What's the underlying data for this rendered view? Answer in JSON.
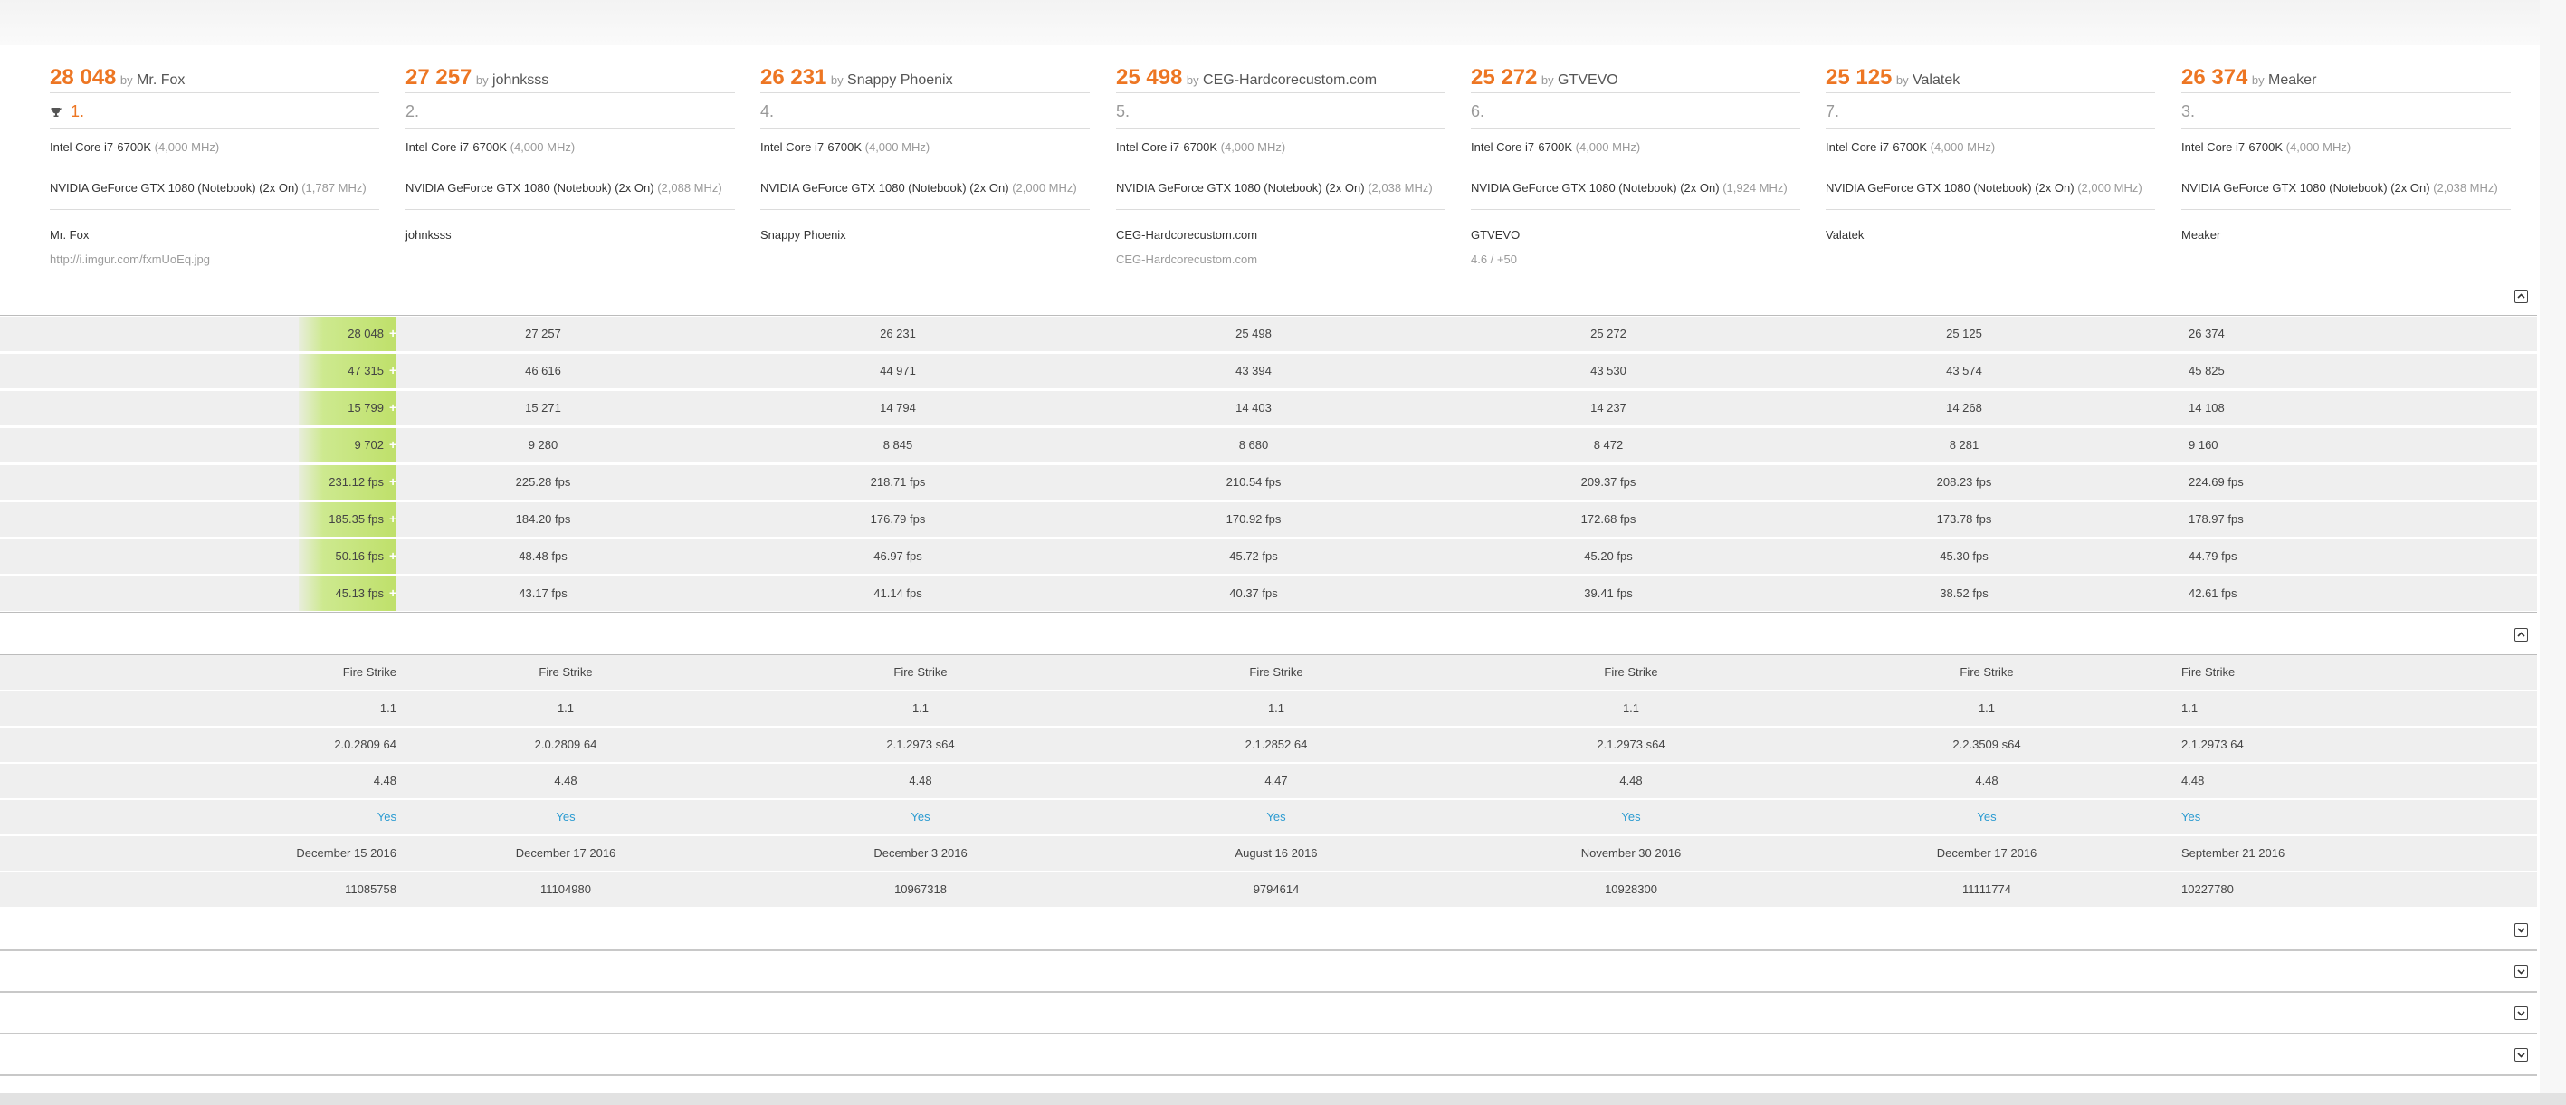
{
  "submissions": [
    {
      "score": "28 048",
      "by": "by",
      "author": "Mr. Fox",
      "rank": "1.",
      "cpu": "Intel Core i7-6700K",
      "cpu_freq": "(4,000 MHz)",
      "gpu": "NVIDIA GeForce GTX 1080 (Notebook) (2x On)",
      "gpu_freq": "(1,787 MHz)",
      "user": "Mr. Fox",
      "note": "http://i.imgur.com/fxmUoEq.jpg"
    },
    {
      "score": "27 257",
      "by": "by",
      "author": "johnksss",
      "rank": "2.",
      "cpu": "Intel Core i7-6700K",
      "cpu_freq": "(4,000 MHz)",
      "gpu": "NVIDIA GeForce GTX 1080 (Notebook) (2x On)",
      "gpu_freq": "(2,088 MHz)",
      "user": "johnksss",
      "note": ""
    },
    {
      "score": "26 231",
      "by": "by",
      "author": "Snappy Phoenix",
      "rank": "4.",
      "cpu": "Intel Core i7-6700K",
      "cpu_freq": "(4,000 MHz)",
      "gpu": "NVIDIA GeForce GTX 1080 (Notebook) (2x On)",
      "gpu_freq": "(2,000 MHz)",
      "user": "Snappy Phoenix",
      "note": ""
    },
    {
      "score": "25 498",
      "by": "by",
      "author": "CEG-Hardcorecustom.com",
      "rank": "5.",
      "cpu": "Intel Core i7-6700K",
      "cpu_freq": "(4,000 MHz)",
      "gpu": "NVIDIA GeForce GTX 1080 (Notebook) (2x On)",
      "gpu_freq": "(2,038 MHz)",
      "user": "CEG-Hardcorecustom.com",
      "note": "CEG-Hardcorecustom.com"
    },
    {
      "score": "25 272",
      "by": "by",
      "author": "GTVEVO",
      "rank": "6.",
      "cpu": "Intel Core i7-6700K",
      "cpu_freq": "(4,000 MHz)",
      "gpu": "NVIDIA GeForce GTX 1080 (Notebook) (2x On)",
      "gpu_freq": "(1,924 MHz)",
      "user": "GTVEVO",
      "note": "4.6 / +50"
    },
    {
      "score": "25 125",
      "by": "by",
      "author": "Valatek",
      "rank": "7.",
      "cpu": "Intel Core i7-6700K",
      "cpu_freq": "(4,000 MHz)",
      "gpu": "NVIDIA GeForce GTX 1080 (Notebook) (2x On)",
      "gpu_freq": "(2,000 MHz)",
      "user": "Valatek",
      "note": ""
    },
    {
      "score": "26 374",
      "by": "by",
      "author": "Meaker",
      "rank": "3.",
      "cpu": "Intel Core i7-6700K",
      "cpu_freq": "(4,000 MHz)",
      "gpu": "NVIDIA GeForce GTX 1080 (Notebook) (2x On)",
      "gpu_freq": "(2,038 MHz)",
      "user": "Meaker",
      "note": ""
    }
  ],
  "scores_table": [
    [
      "28 048",
      "27 257",
      "26 231",
      "25 498",
      "25 272",
      "25 125",
      "26 374"
    ],
    [
      "47 315",
      "46 616",
      "44 971",
      "43 394",
      "43 530",
      "43 574",
      "45 825"
    ],
    [
      "15 799",
      "15 271",
      "14 794",
      "14 403",
      "14 237",
      "14 268",
      "14 108"
    ],
    [
      "9 702",
      "9 280",
      "8 845",
      "8 680",
      "8 472",
      "8 281",
      "9 160"
    ],
    [
      "231.12 fps",
      "225.28 fps",
      "218.71 fps",
      "210.54 fps",
      "209.37 fps",
      "208.23 fps",
      "224.69 fps"
    ],
    [
      "185.35 fps",
      "184.20 fps",
      "176.79 fps",
      "170.92 fps",
      "172.68 fps",
      "173.78 fps",
      "178.97 fps"
    ],
    [
      "50.16 fps",
      "48.48 fps",
      "46.97 fps",
      "45.72 fps",
      "45.20 fps",
      "45.30 fps",
      "44.79 fps"
    ],
    [
      "45.13 fps",
      "43.17 fps",
      "41.14 fps",
      "40.37 fps",
      "39.41 fps",
      "38.52 fps",
      "42.61 fps"
    ]
  ],
  "details_table": [
    [
      "Fire Strike",
      "Fire Strike",
      "Fire Strike",
      "Fire Strike",
      "Fire Strike",
      "Fire Strike",
      "Fire Strike"
    ],
    [
      "1.1",
      "1.1",
      "1.1",
      "1.1",
      "1.1",
      "1.1",
      "1.1"
    ],
    [
      "2.0.2809 64",
      "2.0.2809 64",
      "2.1.2973 s64",
      "2.1.2852 64",
      "2.1.2973 s64",
      "2.2.3509 s64",
      "2.1.2973 64"
    ],
    [
      "4.48",
      "4.48",
      "4.48",
      "4.47",
      "4.48",
      "4.48",
      "4.48"
    ],
    [
      "Yes",
      "Yes",
      "Yes",
      "Yes",
      "Yes",
      "Yes",
      "Yes"
    ],
    [
      "December 15 2016",
      "December 17 2016",
      "December 3 2016",
      "August 16 2016",
      "November 30 2016",
      "December 17 2016",
      "September 21 2016"
    ],
    [
      "11085758",
      "11104980",
      "10967318",
      "9794614",
      "10928300",
      "11111774",
      "10227780"
    ]
  ],
  "plus_glyph": "+",
  "icons": {
    "trophy": "trophy-icon",
    "collapse": "collapse-icon",
    "expand": "expand-icon"
  },
  "colors": {
    "score": "#ed7623",
    "best": "#c6e47c",
    "link": "#2b9bd1"
  }
}
